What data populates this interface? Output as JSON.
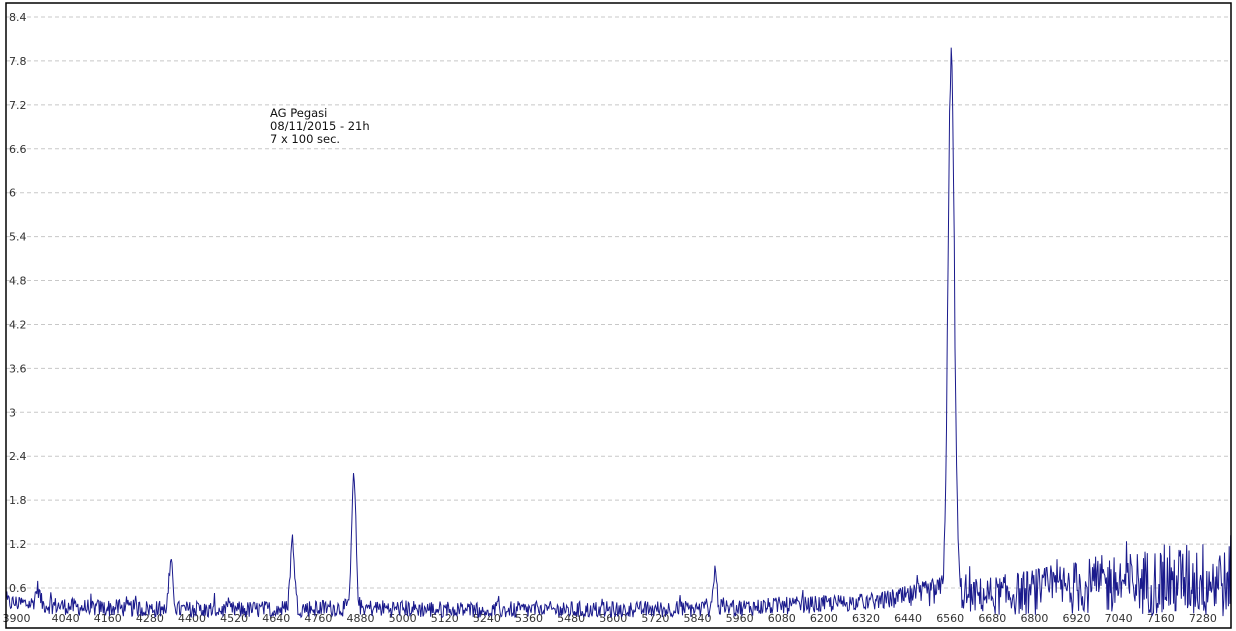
{
  "annotation": {
    "line1": "AG Pegasi",
    "line2": "08/11/2015 - 21h",
    "line3": "7 x 100 sec."
  },
  "colors": {
    "series": "#1a1a8c",
    "grid": "#c8c8c8",
    "frame": "#000000"
  },
  "chart_data": {
    "type": "line",
    "title": "",
    "xlabel": "",
    "ylabel": "",
    "xlim": [
      3870,
      7360
    ],
    "ylim": [
      0.2,
      8.5
    ],
    "grid": true,
    "y_ticks": [
      "0.6",
      "1.2",
      "1.8",
      "2.4",
      "3",
      "3.6",
      "4.2",
      "4.8",
      "5.4",
      "6",
      "6.6",
      "7.2",
      "7.8",
      "8.4"
    ],
    "x_ticks": [
      "3900",
      "4040",
      "4160",
      "4280",
      "4400",
      "4520",
      "4640",
      "4760",
      "4880",
      "5000",
      "5120",
      "5240",
      "5360",
      "5480",
      "5600",
      "5720",
      "5840",
      "5960",
      "6080",
      "6200",
      "6320",
      "6440",
      "6560",
      "6680",
      "6800",
      "6920",
      "7040",
      "7160",
      "7280"
    ],
    "baseline": {
      "x": [
        3870,
        3950,
        4100,
        4250,
        4400,
        4550,
        4700,
        4850,
        5000,
        5150,
        5300,
        5450,
        5600,
        5750,
        5900,
        6050,
        6200,
        6350,
        6450,
        6520,
        6600,
        6700,
        6800,
        6900,
        7000,
        7100,
        7200,
        7300,
        7360
      ],
      "y": [
        0.4,
        0.38,
        0.33,
        0.32,
        0.3,
        0.3,
        0.32,
        0.33,
        0.32,
        0.3,
        0.3,
        0.3,
        0.3,
        0.31,
        0.32,
        0.35,
        0.38,
        0.42,
        0.48,
        0.55,
        0.5,
        0.5,
        0.55,
        0.6,
        0.65,
        0.68,
        0.7,
        0.72,
        0.72
      ]
    },
    "peaks": [
      {
        "x": 4340,
        "y": 0.9,
        "width": 6
      },
      {
        "x": 4686,
        "y": 1.25,
        "width": 6
      },
      {
        "x": 4861,
        "y": 2.1,
        "width": 6
      },
      {
        "x": 5890,
        "y": 0.85,
        "width": 5
      },
      {
        "x": 3960,
        "y": 0.6,
        "width": 6
      },
      {
        "x": 6563,
        "y": 7.85,
        "width": 9
      }
    ],
    "series": [
      {
        "values_desc": "spectrum intensity"
      }
    ]
  }
}
